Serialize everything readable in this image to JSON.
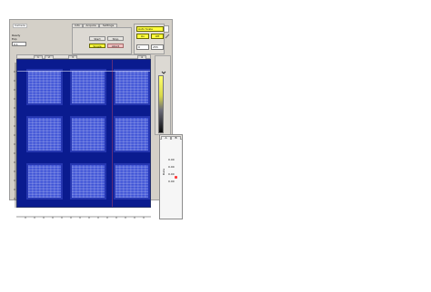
{
  "top_left": {
    "label": "Camera"
  },
  "left_controls": {
    "status_label": "Ready",
    "field_label": "Exp",
    "field_value": "0.1"
  },
  "tabs": {
    "items": [
      {
        "label": "Info"
      },
      {
        "label": "Acquire"
      },
      {
        "label": "Settings"
      }
    ]
  },
  "acquire_buttons": {
    "start": "Start",
    "stop": "Stop",
    "single": "Single",
    "abort": "Abort"
  },
  "yellow_panel": {
    "title": "Auto Scale",
    "btn1": "On",
    "btn2": "Off",
    "field1": "0",
    "field2": "255"
  },
  "image_view": {
    "header_tabs": [
      "1",
      "2",
      "3",
      "4"
    ]
  },
  "right_panel": {
    "tabs": [
      "A",
      "B"
    ],
    "values": [
      "0.00",
      "0.00",
      "0.00",
      "0.00"
    ],
    "vertical_label": "Data"
  },
  "colors": {
    "image_bg": "#0a1b8f",
    "tile_fill": "#3e53d6",
    "accent_yellow": "#ffff3c"
  },
  "icons": {
    "corner": "window-corner-icon",
    "scroll_arrow": "chevron-down-icon"
  }
}
